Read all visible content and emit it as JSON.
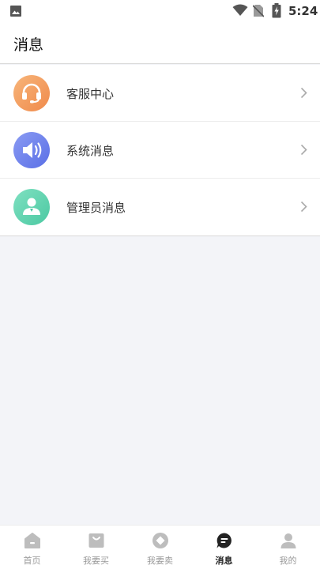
{
  "status_bar": {
    "time": "5:24"
  },
  "header": {
    "title": "消息"
  },
  "messages": {
    "items": [
      {
        "label": "客服中心",
        "icon": "headset-icon",
        "color_from": "#f7b57a",
        "color_to": "#f08a4b"
      },
      {
        "label": "系统消息",
        "icon": "speaker-icon",
        "color_from": "#8a9bf3",
        "color_to": "#5a6fe6"
      },
      {
        "label": "管理员消息",
        "icon": "admin-user-icon",
        "color_from": "#7fe0c1",
        "color_to": "#4cc9a2"
      }
    ]
  },
  "tabbar": {
    "active_color": "#222222",
    "inactive_color": "#999999",
    "items": [
      {
        "label": "首页",
        "icon": "home-icon"
      },
      {
        "label": "我要买",
        "icon": "shopping-bag-icon"
      },
      {
        "label": "我要卖",
        "icon": "sell-diamond-icon"
      },
      {
        "label": "消息",
        "icon": "message-icon",
        "active": true
      },
      {
        "label": "我的",
        "icon": "person-icon"
      }
    ]
  }
}
